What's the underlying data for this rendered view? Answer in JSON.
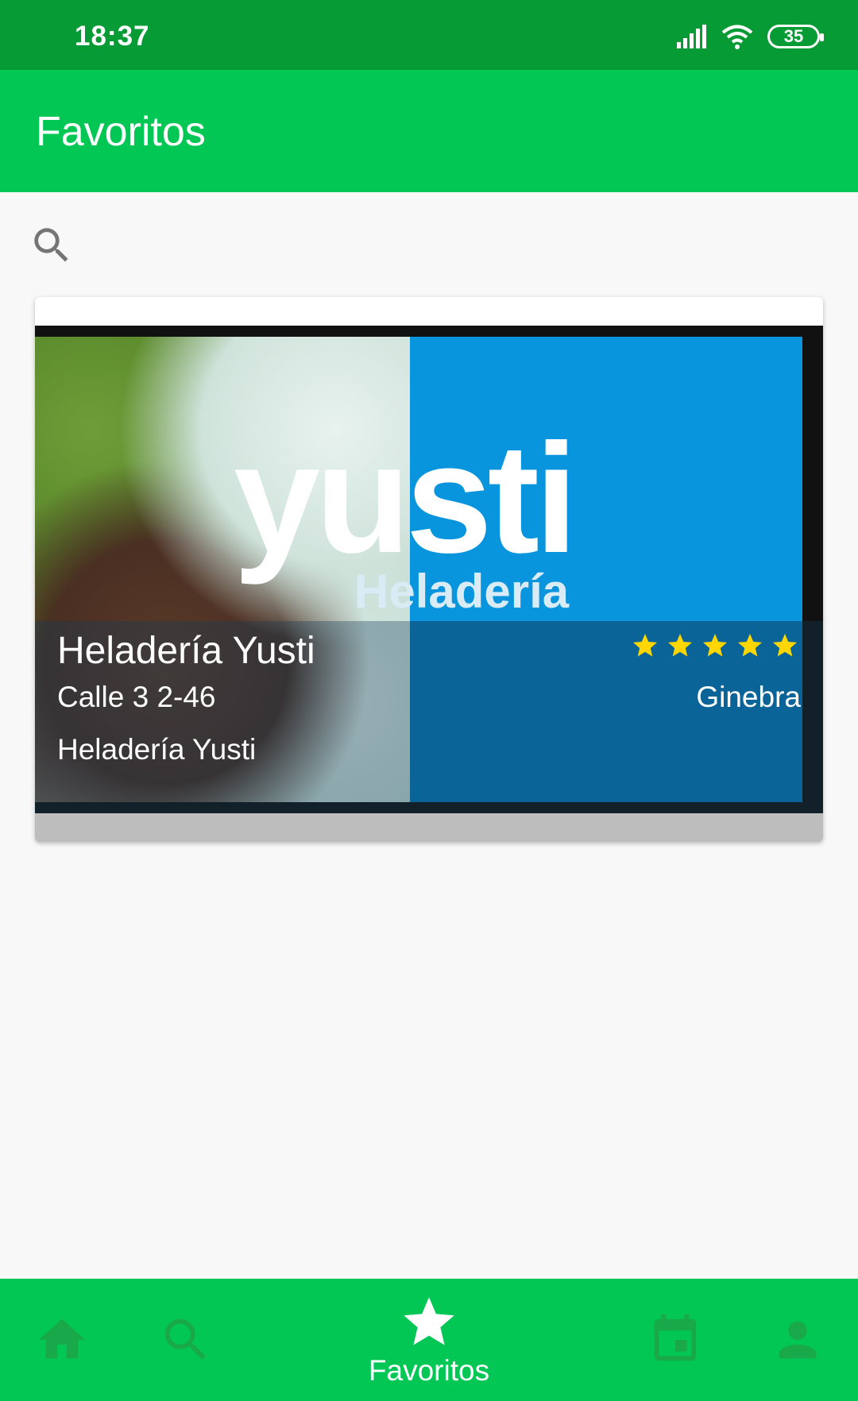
{
  "status_bar": {
    "time": "18:37",
    "battery": "35"
  },
  "app_bar": {
    "title": "Favoritos"
  },
  "search": {
    "icon": "search-icon"
  },
  "favorites": [
    {
      "image_logo_text": "yusti",
      "image_logo_sub": "Heladería",
      "name": "Heladería Yusti",
      "address": "Calle 3 2-46",
      "description": "Heladería Yusti",
      "category": "Ginebra",
      "rating": 5
    }
  ],
  "bottom_nav": {
    "items": [
      {
        "icon": "home-icon"
      },
      {
        "icon": "search-icon"
      },
      {
        "icon": "star-icon",
        "label": "Favoritos",
        "active": true
      },
      {
        "icon": "calendar-icon"
      },
      {
        "icon": "person-icon"
      }
    ]
  },
  "colors": {
    "status_bar": "#079b35",
    "app_bar": "#02c755",
    "nav_inactive": "#19a94a",
    "nav_active": "#ffffff",
    "star": "#ffd600"
  }
}
